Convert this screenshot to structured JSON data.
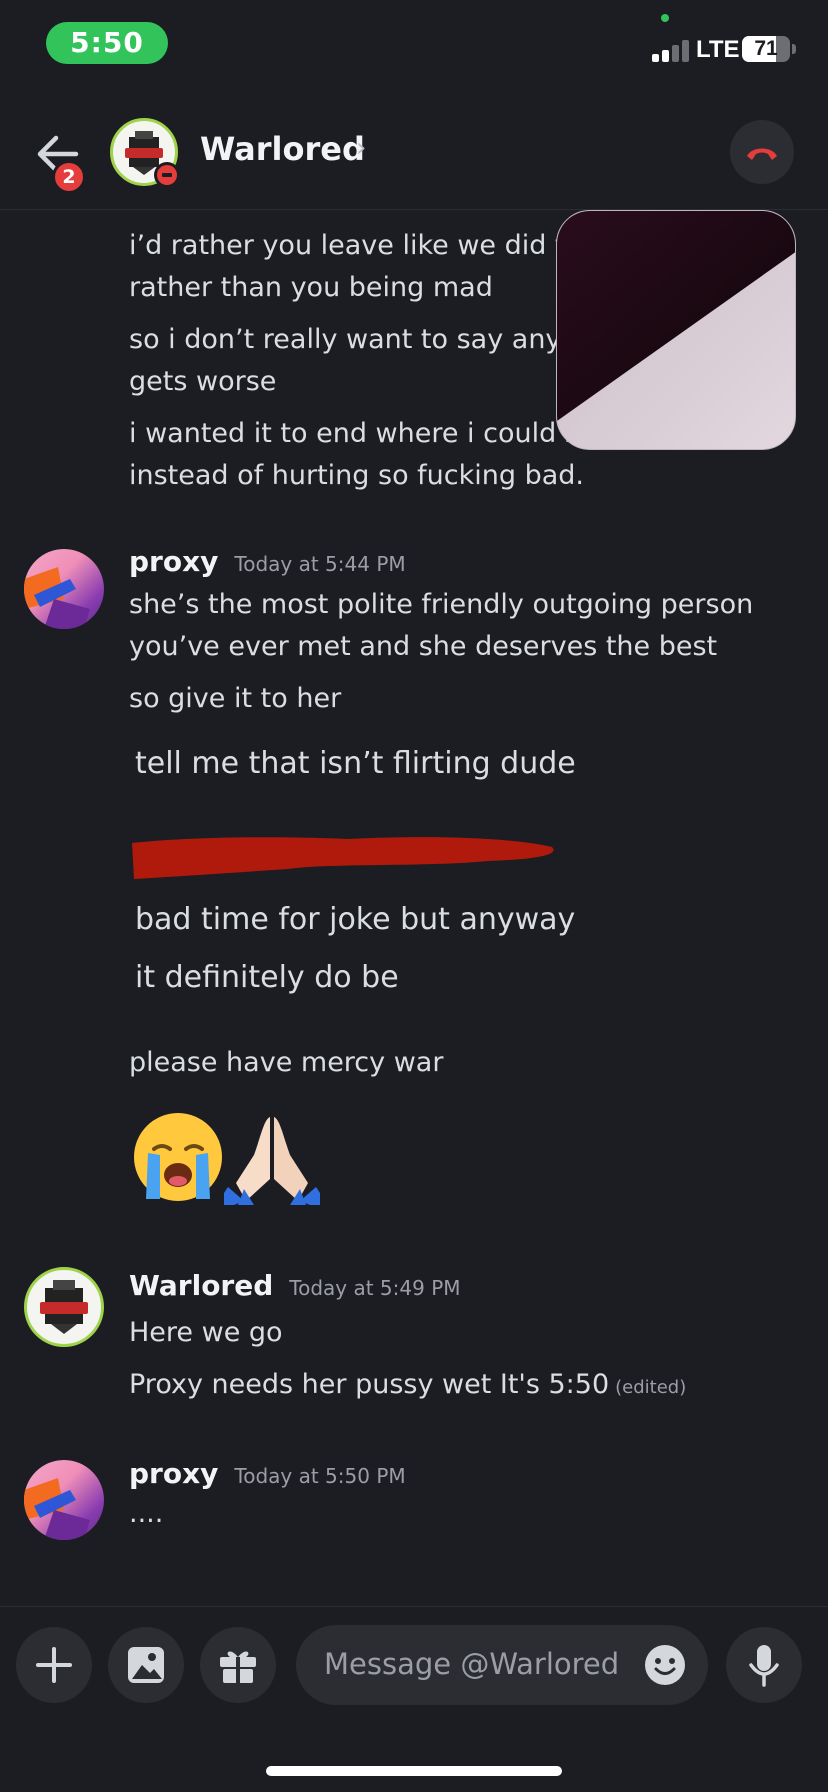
{
  "status_bar": {
    "time": "5:50",
    "network": "LTE",
    "battery": "71",
    "battery_level": 0.71
  },
  "header": {
    "name": "Warlored",
    "unread_badge": "2"
  },
  "messages": {
    "continued": [
      "i’d rather you leave like we did th",
      "rather than you being mad",
      "so i don’t really want to say anyt",
      "gets worse",
      "i wanted it to end where i could st",
      "instead of hurting so fucking bad."
    ],
    "group1": {
      "author": "proxy",
      "timestamp": "Today at 5:44 PM",
      "lines": [
        "she’s the most polite friendly outgoing person",
        "you’ve ever met and she deserves the best",
        "so give it to her"
      ],
      "quoted": [
        "tell me that isn’t flirting dude",
        "bad time for joke but anyway",
        "it definitely do be"
      ],
      "after": "please have mercy war",
      "emojis": [
        "loudly-crying-face",
        "folded-hands"
      ]
    },
    "group2": {
      "author": "Warlored",
      "timestamp": "Today at 5:49 PM",
      "lines": [
        "Here we go",
        "Proxy needs her pussy wet It's 5:50"
      ],
      "edited": "(edited)"
    },
    "group3": {
      "author": "proxy",
      "timestamp": "Today at 5:50 PM",
      "lines": [
        "...."
      ]
    }
  },
  "composer": {
    "placeholder": "Message @Warlored"
  },
  "colors": {
    "background": "#1c1d22",
    "status_green": "#32c45a",
    "danger": "#e53c3c",
    "redaction": "#b01a0c"
  }
}
